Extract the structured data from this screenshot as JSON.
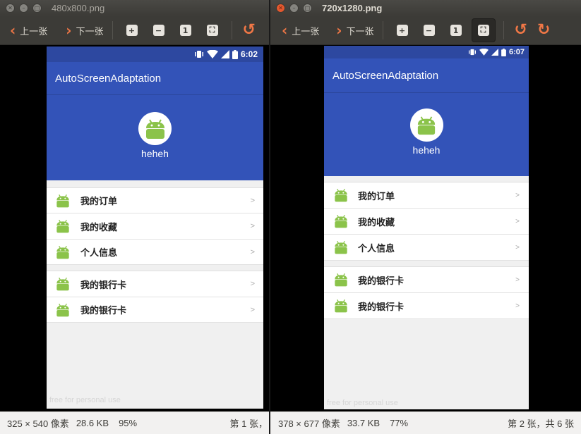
{
  "left": {
    "title": "480x800.png",
    "toolbar": {
      "prev": "上一张",
      "next": "下一张"
    },
    "status": {
      "dims": "325 × 540 像素",
      "size": "28.6 KB",
      "zoom": "95%",
      "page": "第 1 张，"
    },
    "phone": {
      "time": "6:02",
      "app_title": "AutoScreenAdaptation",
      "username": "heheh",
      "group1": [
        {
          "label": "我的订单",
          "arrow": ">"
        },
        {
          "label": "我的收藏",
          "arrow": ">"
        },
        {
          "label": "个人信息",
          "arrow": ">"
        }
      ],
      "group2": [
        {
          "label": "我的银行卡",
          "arrow": ">"
        },
        {
          "label": "我的银行卡",
          "arrow": ">"
        }
      ],
      "watermark": "free for personal use"
    }
  },
  "right": {
    "title": "720x1280.png",
    "toolbar": {
      "prev": "上一张",
      "next": "下一张"
    },
    "status": {
      "dims": "378 × 677 像素",
      "size": "33.7 KB",
      "zoom": "77%",
      "page": "第 2 张，共 6 张"
    },
    "phone": {
      "time": "6:07",
      "app_title": "AutoScreenAdaptation",
      "username": "heheh",
      "group1": [
        {
          "label": "我的订单",
          "arrow": ">"
        },
        {
          "label": "我的收藏",
          "arrow": ">"
        },
        {
          "label": "个人信息",
          "arrow": ">"
        }
      ],
      "group2": [
        {
          "label": "我的银行卡",
          "arrow": ">"
        },
        {
          "label": "我的银行卡",
          "arrow": ">"
        }
      ],
      "watermark": "free for personal use"
    }
  },
  "colors": {
    "primary": "#3353b8",
    "statusbar": "#2d48a0",
    "accent_orange": "#f07746",
    "android_green": "#8bc34a"
  }
}
